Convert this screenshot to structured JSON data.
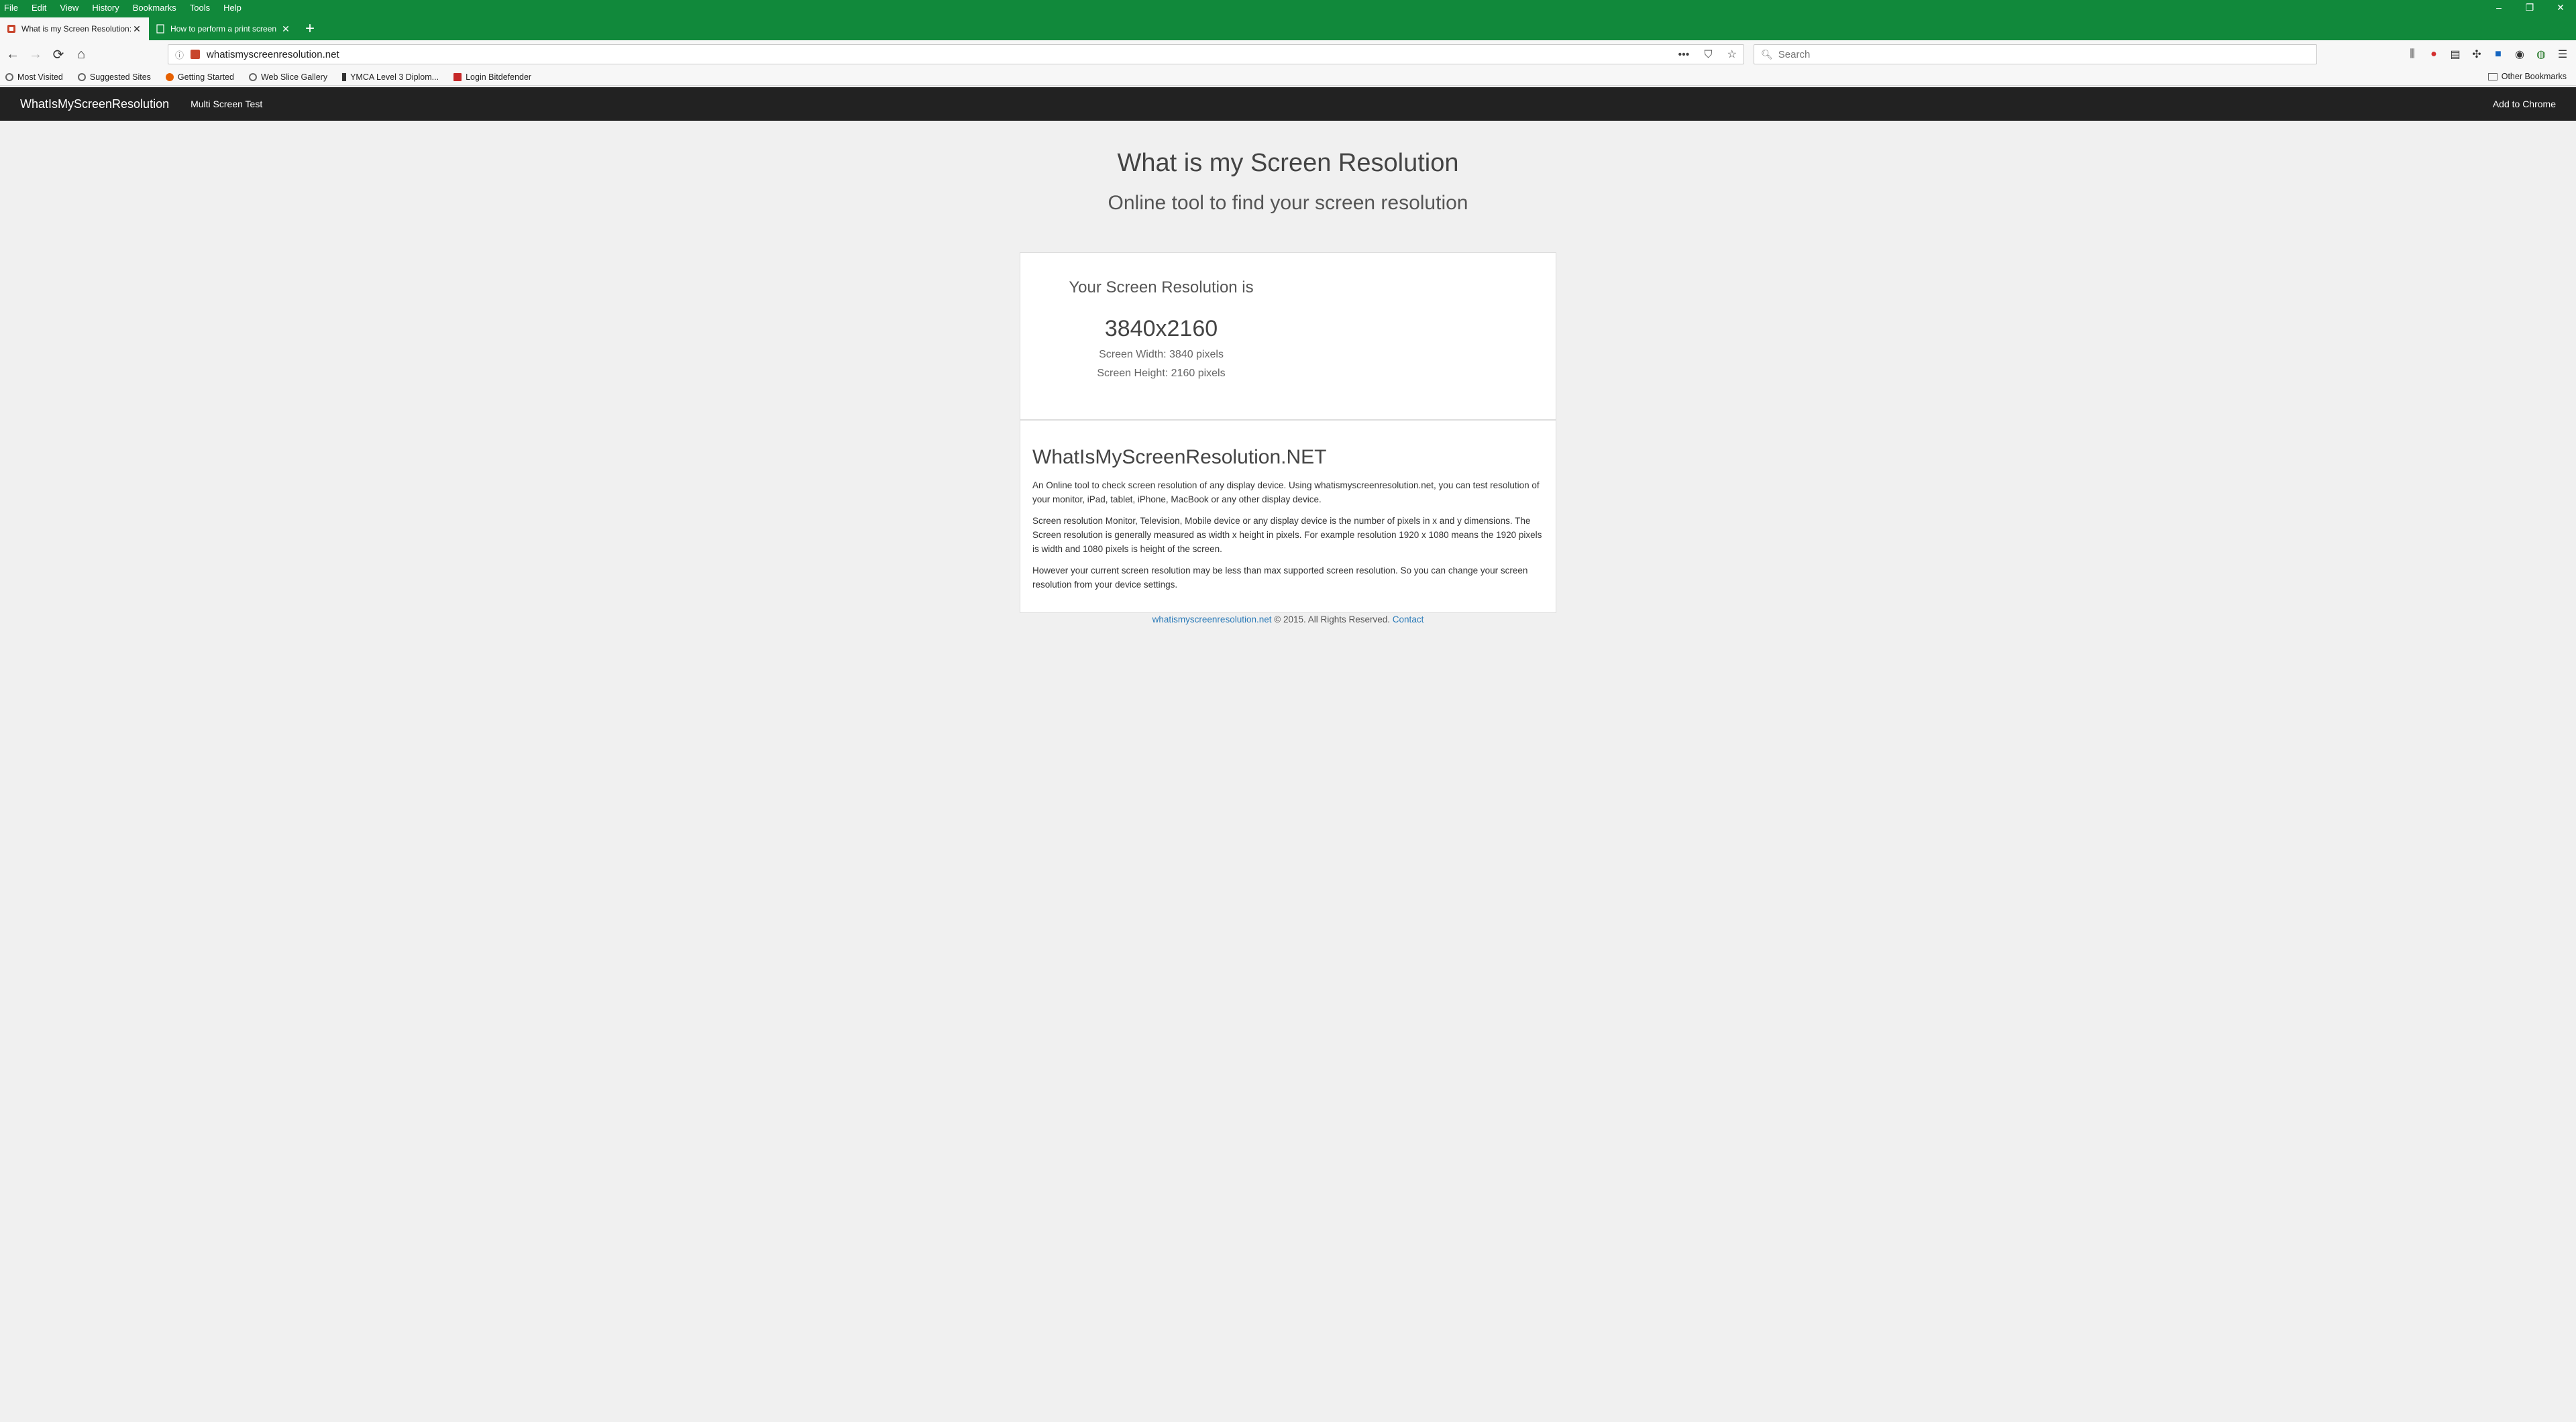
{
  "browser": {
    "menu": [
      "File",
      "Edit",
      "View",
      "History",
      "Bookmarks",
      "Tools",
      "Help"
    ],
    "window_controls": {
      "minimize": "–",
      "restore": "❐",
      "close": "✕"
    },
    "tabs": [
      {
        "title": "What is my Screen Resolution: Find",
        "active": true
      },
      {
        "title": "How to perform a print screen",
        "active": false
      }
    ],
    "new_tab": "+",
    "url": "whatismyscreenresolution.net",
    "search_placeholder": "Search",
    "bookmarks": [
      {
        "label": "Most Visited",
        "color": "#666666"
      },
      {
        "label": "Suggested Sites",
        "color": "#666666"
      },
      {
        "label": "Getting Started",
        "color": "#e66000"
      },
      {
        "label": "Web Slice Gallery",
        "color": "#666666"
      },
      {
        "label": "YMCA Level 3 Diplom...",
        "color": "#333333"
      },
      {
        "label": "Login Bitdefender",
        "color": "#c62828"
      }
    ],
    "other_bookmarks": "Other Bookmarks"
  },
  "site": {
    "brand": "WhatIsMyScreenResolution",
    "nav_link": "Multi Screen Test",
    "nav_right": "Add to Chrome",
    "title": "What is my Screen Resolution",
    "subtitle": "Online tool to find your screen resolution",
    "result": {
      "heading": "Your Screen Resolution is",
      "value": "3840x2160",
      "width_line": "Screen Width: 3840 pixels",
      "height_line": "Screen Height: 2160 pixels"
    },
    "info": {
      "title": "WhatIsMyScreenResolution.NET",
      "paragraphs": [
        "An Online tool to check screen resolution of any display device. Using whatismyscreenresolution.net, you can test resolution of your monitor, iPad, tablet, iPhone, MacBook or any other display device.",
        "Screen resolution Monitor, Television, Mobile device or any display device is the number of pixels in x and y dimensions. The Screen resolution is generally measured as width x height in pixels. For example resolution 1920 x 1080 means the 1920 pixels is width and 1080 pixels is height of the screen.",
        "However your current screen resolution may be less than max supported screen resolution. So you can change your screen resolution from your device settings."
      ]
    },
    "footer": {
      "site_link": "whatismyscreenresolution.net",
      "copyright": " © 2015. All Rights Reserved. ",
      "contact": "Contact"
    }
  }
}
